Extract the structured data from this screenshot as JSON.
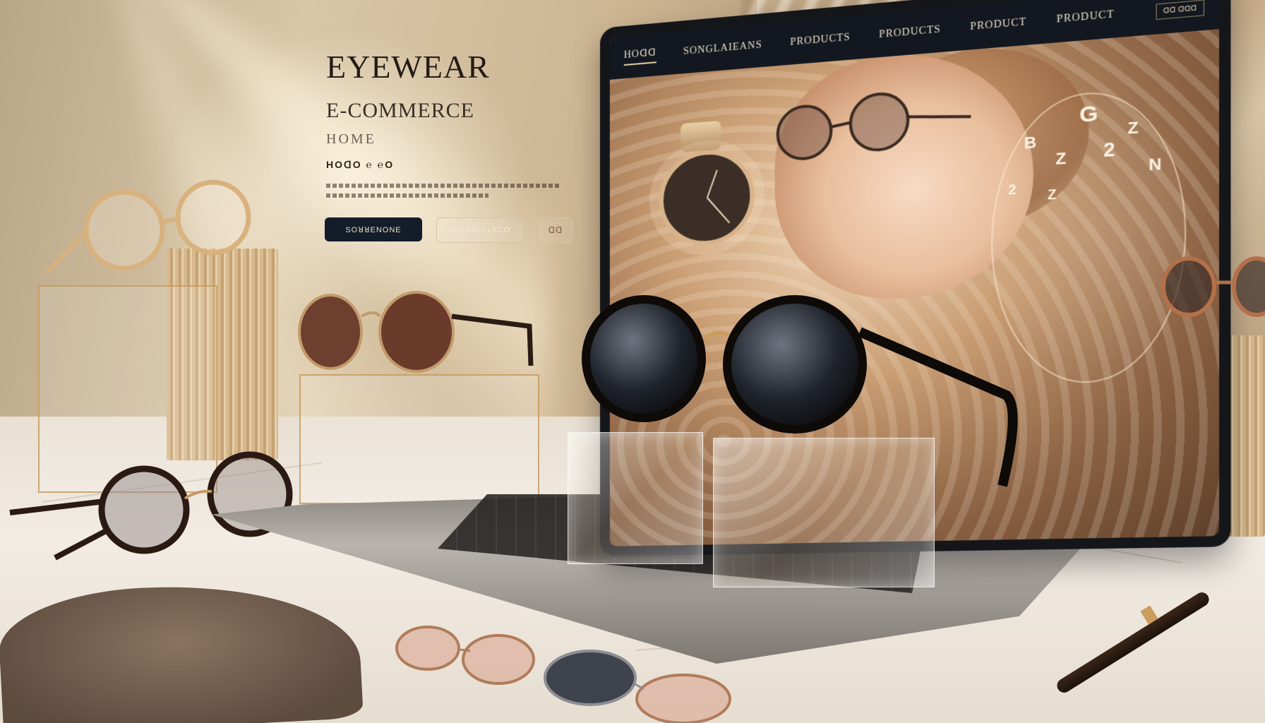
{
  "hero": {
    "title": "EYEWEAR",
    "subtitle": "E-COMMERCE",
    "home_label": "HOME",
    "tagline": "HOꓷO ℮ ℮O",
    "buttons": [
      {
        "label": "SOꓤꓤENONE"
      },
      {
        "label": "GIRANLLLTCO"
      },
      {
        "label": "ꓷꓷ"
      }
    ]
  },
  "site_nav": {
    "items": [
      {
        "label": "HOꓷꓷ"
      },
      {
        "label": "SONGLAIEANS"
      },
      {
        "label": "PRODUCTS"
      },
      {
        "label": "PRODUCTS"
      },
      {
        "label": "PRODUCT"
      },
      {
        "label": "PRODUCT"
      }
    ],
    "action_label": "ꓷꓷ ꓷꓷꓷ"
  },
  "screen_dial": {
    "chars": [
      "G",
      "B",
      "Z",
      "2",
      "Z",
      "N",
      "2",
      "Z"
    ]
  },
  "colors": {
    "nav_bg": "#131820",
    "primary_btn_bg": "#131d2a",
    "accent_gold": "#c99d5b"
  }
}
